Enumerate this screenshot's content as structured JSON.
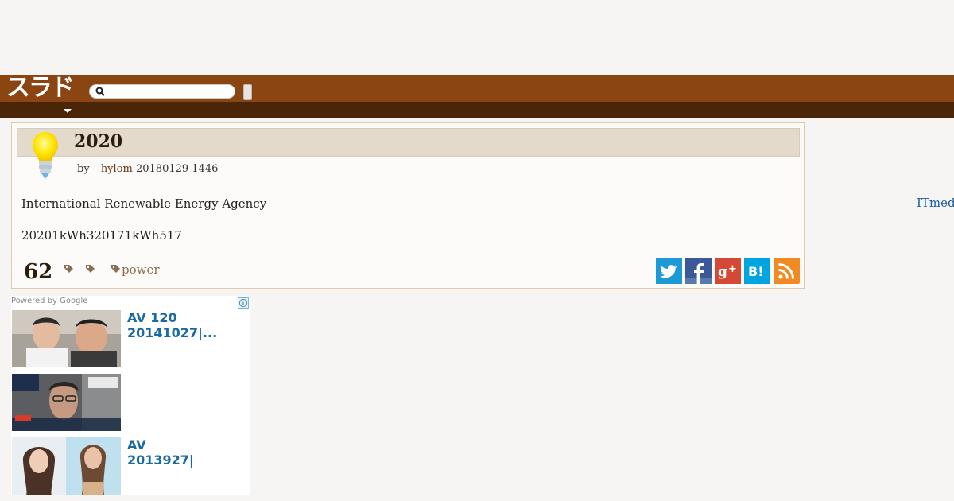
{
  "header": {
    "logo_text": "スラド",
    "search_placeholder": "",
    "brand_color": "#8b4513",
    "subbar_color": "#4a2508"
  },
  "article": {
    "title": "2020",
    "byline_by": "by",
    "author": "hylom",
    "date": "20180129 1446",
    "body_line1": "International Renewable Energy Agency",
    "body_line2": "20201kWh320171kWh517",
    "comment_count": "62",
    "tag": "power",
    "topic_icon": "lightbulb-icon"
  },
  "share_buttons": [
    {
      "name": "twitter",
      "icon": "twitter-icon",
      "color": "#1d9ad6"
    },
    {
      "name": "facebook",
      "icon": "facebook-icon",
      "color": "#3b5998"
    },
    {
      "name": "google-plus",
      "icon": "google-plus-icon",
      "color": "#d34836"
    },
    {
      "name": "hatena-bookmark",
      "icon": "hatena-bookmark-icon",
      "color": "#00a4de",
      "label": "B!"
    },
    {
      "name": "rss",
      "icon": "rss-icon",
      "color": "#f08a24"
    }
  ],
  "side_link": {
    "text": "ITmed"
  },
  "ads": {
    "powered_by": "Powered by Google",
    "items": [
      {
        "line1": "AV 120",
        "line2": "20141027|..."
      },
      {
        "line1": "",
        "line2": ""
      },
      {
        "line1": "AV",
        "line2": "2013927|"
      }
    ]
  }
}
